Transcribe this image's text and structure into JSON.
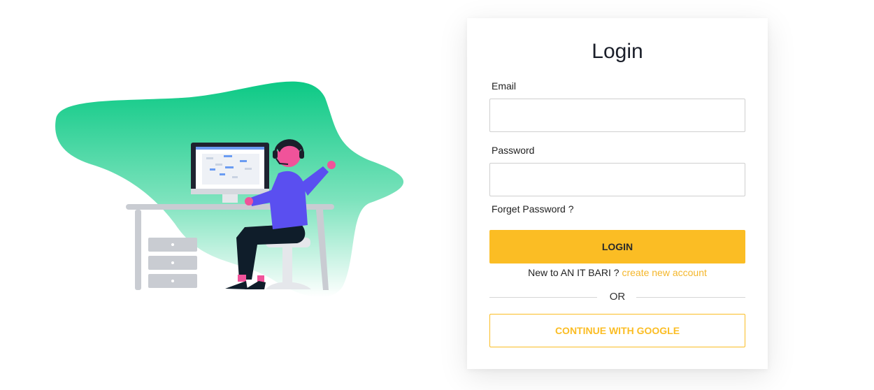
{
  "login": {
    "title": "Login",
    "email_label": "Email",
    "email_value": "",
    "password_label": "Password",
    "password_value": "",
    "forget_password": "Forget Password ?",
    "login_button": "LOGIN",
    "signup_prompt": "New to AN IT BARI ?",
    "signup_link": "create new account",
    "or_text": "OR",
    "google_button": "CONTINUE WITH GOOGLE"
  },
  "colors": {
    "accent": "#fbbd24",
    "blob_top": "#0cc985",
    "blob_bottom": "#ffffff",
    "character_shirt": "#5a4ff0",
    "character_skin": "#f0539a"
  },
  "illustration": {
    "icon": "person-at-computer-illustration"
  }
}
